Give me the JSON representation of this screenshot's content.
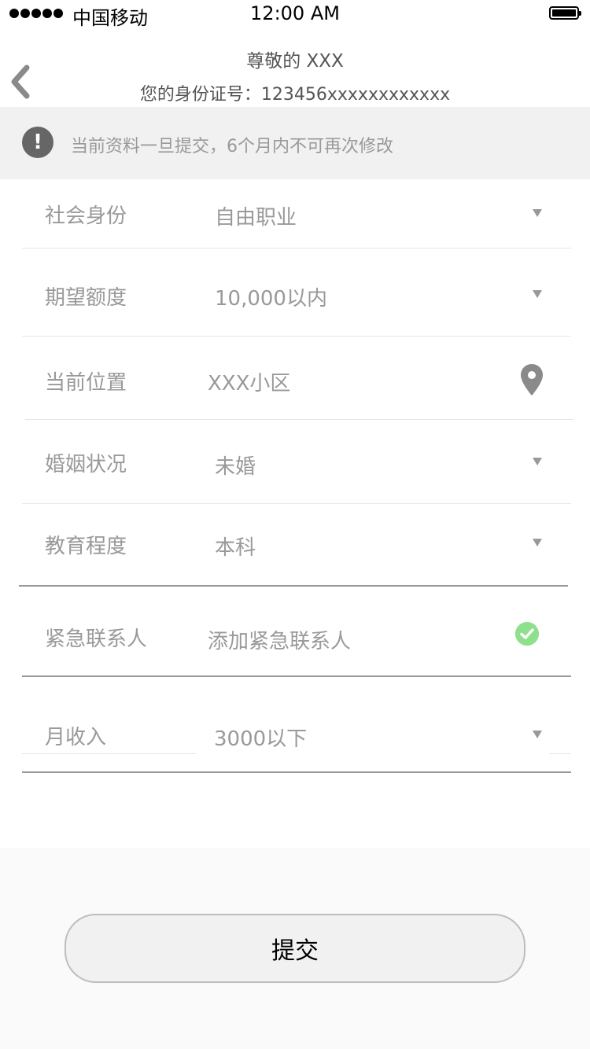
{
  "status_bar": {
    "carrier": "中国移动",
    "time": "12:00 AM"
  },
  "header": {
    "greeting": "尊敬的 XXX",
    "id_line": "您的身份证号：123456xxxxxxxxxxxx",
    "back_icon": "chevron-left-icon"
  },
  "notice": {
    "icon": "exclamation-icon",
    "text": "当前资料一旦提交，6个月内不可再次修改"
  },
  "form": {
    "social_identity": {
      "label": "社会身份",
      "value": "自由职业"
    },
    "expected_amount": {
      "label": "期望额度",
      "value": "10,000以内"
    },
    "current_location": {
      "label": "当前位置",
      "value": "XXX小区"
    },
    "marital_status": {
      "label": "婚姻状况",
      "value": "未婚"
    },
    "education": {
      "label": "教育程度",
      "value": "本科"
    },
    "emergency_contact": {
      "label": "紧急联系人",
      "value": "添加紧急联系人"
    },
    "monthly_income": {
      "label": "月收入",
      "value": "3000以下"
    }
  },
  "submit": {
    "label": "提交"
  },
  "colors": {
    "banner_bg": "#f1f1f1",
    "text_muted": "#999999",
    "check_green": "#8ee08c"
  }
}
